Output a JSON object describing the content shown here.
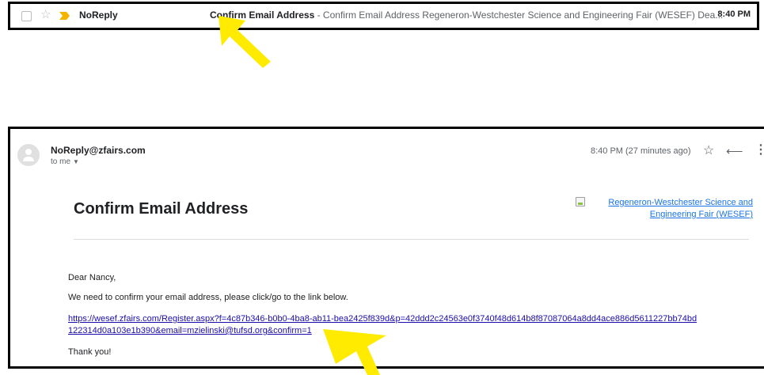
{
  "inbox_row": {
    "sender": "NoReply",
    "subject": "Confirm Email Address",
    "snippet": " - Confirm Email Address Regeneron-Westchester Science and Engineering Fair (WESEF) Dea...",
    "time": "8:40 PM"
  },
  "message": {
    "from": "NoReply@zfairs.com",
    "to": "to me",
    "time": "8:40 PM (27 minutes ago)",
    "title": "Confirm Email Address",
    "logo_alt": "Regeneron-Westchester Science and Engineering Fair (WESEF)",
    "greeting": "Dear Nancy,",
    "intro": "We need to confirm your email address, please click/go to the link below.",
    "link": "https://wesef.zfairs.com/Register.aspx?f=4c87b346-b0b0-4ba8-ab11-bea2425f839d&p=42ddd2c24563e0f3740f48d614b8f87087064a8dd4ace886d5611227bb74bd122314d0a103e1b390&email=mzielinski@tufsd.org&confirm=1",
    "closing": "Thank you!"
  },
  "icons": {
    "checkbox": "checkbox-icon",
    "star": "star-icon",
    "important": "important-marker-icon",
    "avatar": "avatar-icon",
    "reply": "reply-icon",
    "more": "more-vert-icon",
    "arrow": "yellow-arrow-icon"
  },
  "colors": {
    "highlight": "#FFEB00",
    "link": "#1a0dab",
    "important": "#F4B400"
  }
}
